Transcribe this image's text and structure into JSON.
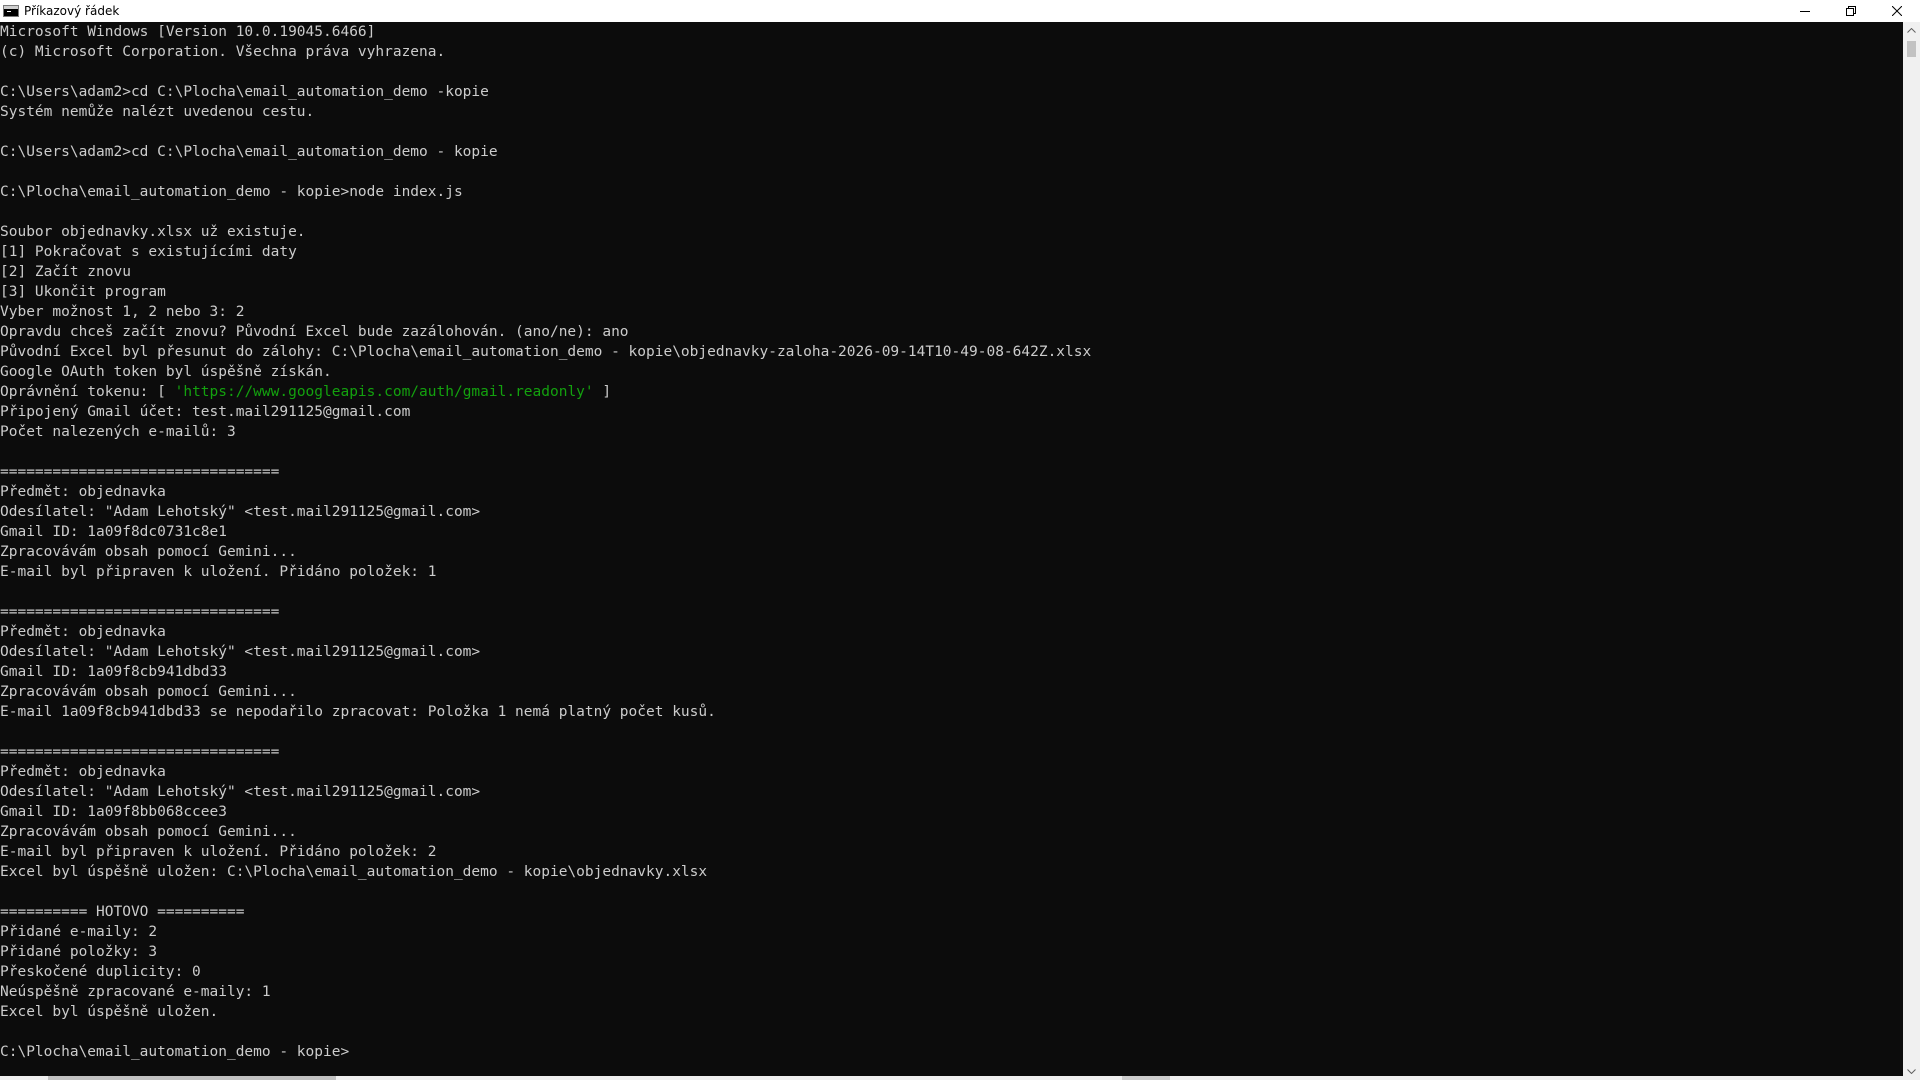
{
  "window": {
    "title": "Příkazový řádek",
    "minimize_icon": "minimize-icon",
    "restore_icon": "restore-icon",
    "close_icon": "close-icon"
  },
  "console": {
    "lines": [
      "Microsoft Windows [Version 10.0.19045.6466]",
      "(c) Microsoft Corporation. Všechna práva vyhrazena.",
      "",
      "C:\\Users\\adam2>cd C:\\Plocha\\email_automation_demo -kopie",
      "Systém nemůže nalézt uvedenou cestu.",
      "",
      "C:\\Users\\adam2>cd C:\\Plocha\\email_automation_demo - kopie",
      "",
      "C:\\Plocha\\email_automation_demo - kopie>node index.js",
      "",
      "Soubor objednavky.xlsx už existuje.",
      "[1] Pokračovat s existujícími daty",
      "[2] Začít znovu",
      "[3] Ukončit program",
      "Vyber možnost 1, 2 nebo 3: 2",
      "Opravdu chceš začít znovu? Původní Excel bude zazálohován. (ano/ne): ano",
      "Původní Excel byl přesunut do zálohy: C:\\Plocha\\email_automation_demo - kopie\\objednavky-zaloha-2026-09-14T10-49-08-642Z.xlsx",
      "Google OAuth token byl úspěšně získán.",
      "Oprávnění tokenu: [ 'https://www.googleapis.com/auth/gmail.readonly' ]",
      "Připojený Gmail účet: test.mail291125@gmail.com",
      "Počet nalezených e-mailů: 3",
      "",
      "================================",
      "Předmět: objednavka",
      "Odesílatel: \"Adam Lehotský\" <test.mail291125@gmail.com>",
      "Gmail ID: 1a09f8dc0731c8e1",
      "Zpracovávám obsah pomocí Gemini...",
      "E-mail byl připraven k uložení. Přidáno položek: 1",
      "",
      "================================",
      "Předmět: objednavka",
      "Odesílatel: \"Adam Lehotský\" <test.mail291125@gmail.com>",
      "Gmail ID: 1a09f8cb941dbd33",
      "Zpracovávám obsah pomocí Gemini...",
      "E-mail 1a09f8cb941dbd33 se nepodařilo zpracovat: Položka 1 nemá platný počet kusů.",
      "",
      "================================",
      "Předmět: objednavka",
      "Odesílatel: \"Adam Lehotský\" <test.mail291125@gmail.com>",
      "Gmail ID: 1a09f8bb068ccee3",
      "Zpracovávám obsah pomocí Gemini...",
      "E-mail byl připraven k uložení. Přidáno položek: 2",
      "Excel byl úspěšně uložen: C:\\Plocha\\email_automation_demo - kopie\\objednavky.xlsx",
      "",
      "========== HOTOVO ==========",
      "Přidané e-maily: 2",
      "Přidané položky: 3",
      "Přeskočené duplicity: 0",
      "Neúspěšně zpracované e-maily: 1",
      "Excel byl úspěšně uložen.",
      "",
      "C:\\Plocha\\email_automation_demo - kopie>"
    ],
    "oauth_line": {
      "prefix": "Oprávnění tokenu: [ ",
      "scope": "'https://www.googleapis.com/auth/gmail.readonly'",
      "suffix": " ]"
    },
    "colors": {
      "background": "#0c0c0c",
      "text": "#cccccc",
      "string": "#13a10e"
    }
  }
}
